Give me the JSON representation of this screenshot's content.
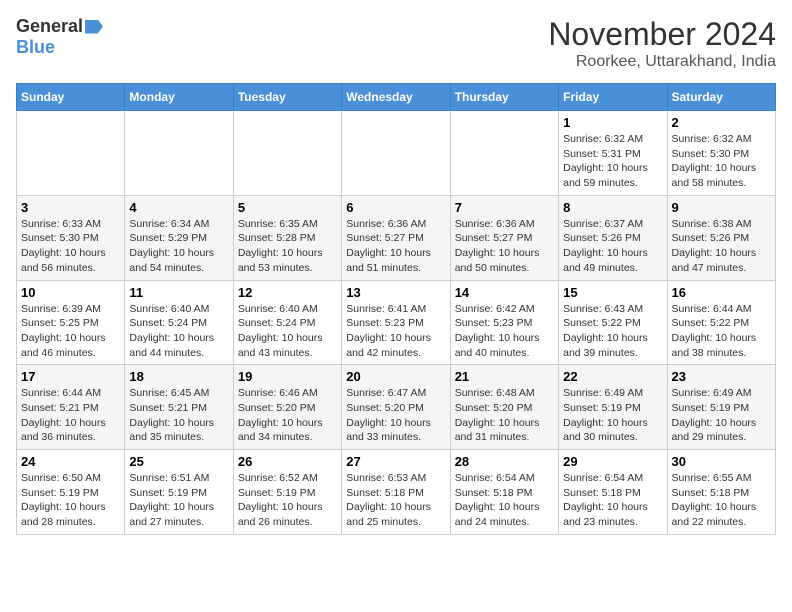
{
  "header": {
    "logo_general": "General",
    "logo_blue": "Blue",
    "month_title": "November 2024",
    "location": "Roorkee, Uttarakhand, India"
  },
  "days_of_week": [
    "Sunday",
    "Monday",
    "Tuesday",
    "Wednesday",
    "Thursday",
    "Friday",
    "Saturday"
  ],
  "weeks": [
    [
      {
        "day": "",
        "info": ""
      },
      {
        "day": "",
        "info": ""
      },
      {
        "day": "",
        "info": ""
      },
      {
        "day": "",
        "info": ""
      },
      {
        "day": "",
        "info": ""
      },
      {
        "day": "1",
        "info": "Sunrise: 6:32 AM\nSunset: 5:31 PM\nDaylight: 10 hours and 59 minutes."
      },
      {
        "day": "2",
        "info": "Sunrise: 6:32 AM\nSunset: 5:30 PM\nDaylight: 10 hours and 58 minutes."
      }
    ],
    [
      {
        "day": "3",
        "info": "Sunrise: 6:33 AM\nSunset: 5:30 PM\nDaylight: 10 hours and 56 minutes."
      },
      {
        "day": "4",
        "info": "Sunrise: 6:34 AM\nSunset: 5:29 PM\nDaylight: 10 hours and 54 minutes."
      },
      {
        "day": "5",
        "info": "Sunrise: 6:35 AM\nSunset: 5:28 PM\nDaylight: 10 hours and 53 minutes."
      },
      {
        "day": "6",
        "info": "Sunrise: 6:36 AM\nSunset: 5:27 PM\nDaylight: 10 hours and 51 minutes."
      },
      {
        "day": "7",
        "info": "Sunrise: 6:36 AM\nSunset: 5:27 PM\nDaylight: 10 hours and 50 minutes."
      },
      {
        "day": "8",
        "info": "Sunrise: 6:37 AM\nSunset: 5:26 PM\nDaylight: 10 hours and 49 minutes."
      },
      {
        "day": "9",
        "info": "Sunrise: 6:38 AM\nSunset: 5:26 PM\nDaylight: 10 hours and 47 minutes."
      }
    ],
    [
      {
        "day": "10",
        "info": "Sunrise: 6:39 AM\nSunset: 5:25 PM\nDaylight: 10 hours and 46 minutes."
      },
      {
        "day": "11",
        "info": "Sunrise: 6:40 AM\nSunset: 5:24 PM\nDaylight: 10 hours and 44 minutes."
      },
      {
        "day": "12",
        "info": "Sunrise: 6:40 AM\nSunset: 5:24 PM\nDaylight: 10 hours and 43 minutes."
      },
      {
        "day": "13",
        "info": "Sunrise: 6:41 AM\nSunset: 5:23 PM\nDaylight: 10 hours and 42 minutes."
      },
      {
        "day": "14",
        "info": "Sunrise: 6:42 AM\nSunset: 5:23 PM\nDaylight: 10 hours and 40 minutes."
      },
      {
        "day": "15",
        "info": "Sunrise: 6:43 AM\nSunset: 5:22 PM\nDaylight: 10 hours and 39 minutes."
      },
      {
        "day": "16",
        "info": "Sunrise: 6:44 AM\nSunset: 5:22 PM\nDaylight: 10 hours and 38 minutes."
      }
    ],
    [
      {
        "day": "17",
        "info": "Sunrise: 6:44 AM\nSunset: 5:21 PM\nDaylight: 10 hours and 36 minutes."
      },
      {
        "day": "18",
        "info": "Sunrise: 6:45 AM\nSunset: 5:21 PM\nDaylight: 10 hours and 35 minutes."
      },
      {
        "day": "19",
        "info": "Sunrise: 6:46 AM\nSunset: 5:20 PM\nDaylight: 10 hours and 34 minutes."
      },
      {
        "day": "20",
        "info": "Sunrise: 6:47 AM\nSunset: 5:20 PM\nDaylight: 10 hours and 33 minutes."
      },
      {
        "day": "21",
        "info": "Sunrise: 6:48 AM\nSunset: 5:20 PM\nDaylight: 10 hours and 31 minutes."
      },
      {
        "day": "22",
        "info": "Sunrise: 6:49 AM\nSunset: 5:19 PM\nDaylight: 10 hours and 30 minutes."
      },
      {
        "day": "23",
        "info": "Sunrise: 6:49 AM\nSunset: 5:19 PM\nDaylight: 10 hours and 29 minutes."
      }
    ],
    [
      {
        "day": "24",
        "info": "Sunrise: 6:50 AM\nSunset: 5:19 PM\nDaylight: 10 hours and 28 minutes."
      },
      {
        "day": "25",
        "info": "Sunrise: 6:51 AM\nSunset: 5:19 PM\nDaylight: 10 hours and 27 minutes."
      },
      {
        "day": "26",
        "info": "Sunrise: 6:52 AM\nSunset: 5:19 PM\nDaylight: 10 hours and 26 minutes."
      },
      {
        "day": "27",
        "info": "Sunrise: 6:53 AM\nSunset: 5:18 PM\nDaylight: 10 hours and 25 minutes."
      },
      {
        "day": "28",
        "info": "Sunrise: 6:54 AM\nSunset: 5:18 PM\nDaylight: 10 hours and 24 minutes."
      },
      {
        "day": "29",
        "info": "Sunrise: 6:54 AM\nSunset: 5:18 PM\nDaylight: 10 hours and 23 minutes."
      },
      {
        "day": "30",
        "info": "Sunrise: 6:55 AM\nSunset: 5:18 PM\nDaylight: 10 hours and 22 minutes."
      }
    ]
  ]
}
